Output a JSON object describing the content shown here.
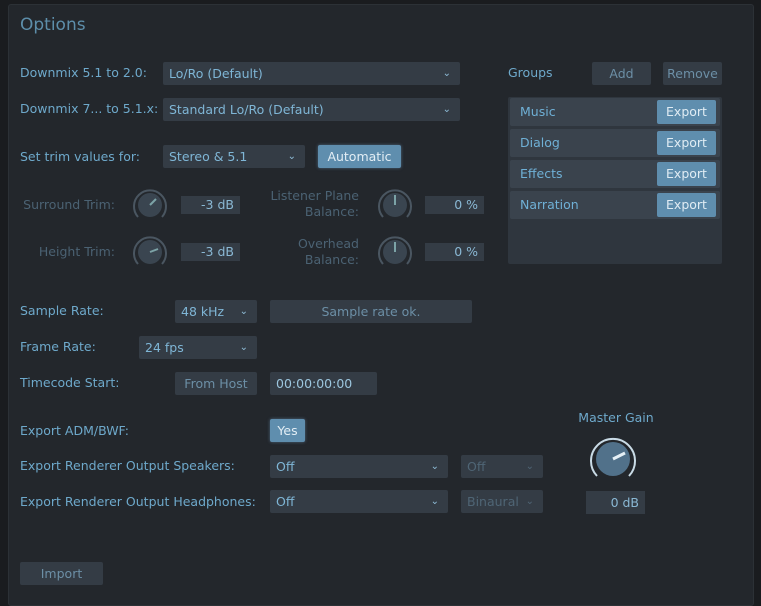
{
  "title": "Options",
  "downmix_51": {
    "label": "Downmix 5.1 to 2.0:",
    "value": "Lo/Ro (Default)"
  },
  "downmix_7": {
    "label": "Downmix 7... to 5.1.x:",
    "value": "Standard Lo/Ro (Default)"
  },
  "trim": {
    "label": "Set trim values for:",
    "value": "Stereo & 5.1",
    "automatic_label": "Automatic"
  },
  "surround_trim": {
    "label": "Surround Trim:",
    "value": "-3 dB"
  },
  "height_trim": {
    "label": "Height Trim:",
    "value": "-3 dB"
  },
  "listener_plane": {
    "label_line1": "Listener Plane",
    "label_line2": "Balance:",
    "value": "0 %"
  },
  "overhead": {
    "label_line1": "Overhead",
    "label_line2": "Balance:",
    "value": "0 %"
  },
  "groups": {
    "label": "Groups",
    "add_label": "Add",
    "remove_label": "Remove",
    "items": [
      {
        "name": "Music",
        "export_label": "Export"
      },
      {
        "name": "Dialog",
        "export_label": "Export"
      },
      {
        "name": "Effects",
        "export_label": "Export"
      },
      {
        "name": "Narration",
        "export_label": "Export"
      }
    ]
  },
  "sample_rate": {
    "label": "Sample Rate:",
    "value": "48 kHz",
    "status": "Sample rate ok."
  },
  "frame_rate": {
    "label": "Frame Rate:",
    "value": "24 fps"
  },
  "timecode": {
    "label": "Timecode Start:",
    "from_host_label": "From Host",
    "value": "00:00:00:00"
  },
  "export_adm": {
    "label": "Export ADM/BWF:",
    "value": "Yes"
  },
  "speakers": {
    "label": "Export Renderer Output Speakers:",
    "value": "Off",
    "secondary": "Off"
  },
  "headphones": {
    "label": "Export Renderer Output Headphones:",
    "value": "Off",
    "secondary": "Binaural"
  },
  "master_gain": {
    "label": "Master Gain",
    "value": "0 dB"
  },
  "import_label": "Import",
  "colors": {
    "accent": "#5f8eae",
    "label": "#6ea9cb",
    "background": "#23272c",
    "control": "#343c45"
  }
}
